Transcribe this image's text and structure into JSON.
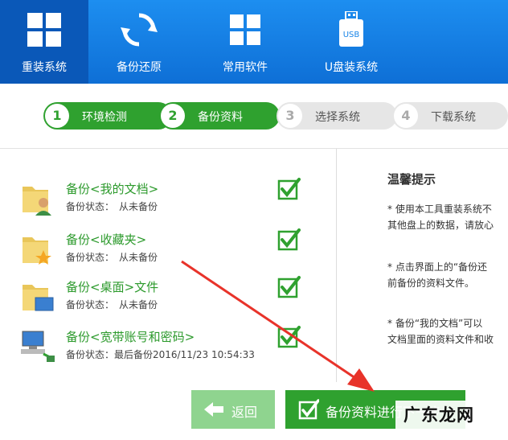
{
  "nav": {
    "items": [
      {
        "label": "重装系统",
        "icon": "windows-logo-icon",
        "active": true
      },
      {
        "label": "备份还原",
        "icon": "refresh-icon",
        "active": false
      },
      {
        "label": "常用软件",
        "icon": "apps-grid-icon",
        "active": false
      },
      {
        "label": "U盘装系统",
        "icon": "usb-drive-icon",
        "badge": "USB",
        "active": false
      }
    ]
  },
  "steps": [
    {
      "num": "1",
      "label": "环境检测",
      "state": "done"
    },
    {
      "num": "2",
      "label": "备份资料",
      "state": "done"
    },
    {
      "num": "3",
      "label": "选择系统",
      "state": "todo"
    },
    {
      "num": "4",
      "label": "下载系统",
      "state": "todo"
    }
  ],
  "backup_items": [
    {
      "title": "备份<我的文档>",
      "status_label": "备份状态：",
      "status_value": "从未备份",
      "icon": "user-folder-icon",
      "checked": true
    },
    {
      "title": "备份<收藏夹>",
      "status_label": "备份状态：",
      "status_value": "从未备份",
      "icon": "favorites-folder-icon",
      "checked": true
    },
    {
      "title": "备份<桌面>文件",
      "status_label": "备份状态：",
      "status_value": "从未备份",
      "icon": "desktop-folder-icon",
      "checked": true
    },
    {
      "title": "备份<宽带账号和密码>",
      "status_label": "备份状态：",
      "status_value": "最后备份2016/11/23 10:54:33",
      "icon": "network-computer-icon",
      "checked": true
    }
  ],
  "tips": {
    "title": "温馨提示",
    "lines": [
      "* 使用本工具重装系统不\n其他盘上的数据，请放心",
      "* 点击界面上的“备份还\n前备份的资料文件。",
      "* 备份“我的文档”可以\n文档里面的资料文件和收"
    ]
  },
  "buttons": {
    "back": "返回",
    "next": "备份资料进行下一步"
  },
  "watermark": "广东龙网",
  "colors": {
    "topbar": "#1a86e8",
    "active_nav": "#0a58b8",
    "green": "#2fa12f",
    "annotation_arrow": "#e8332a"
  }
}
